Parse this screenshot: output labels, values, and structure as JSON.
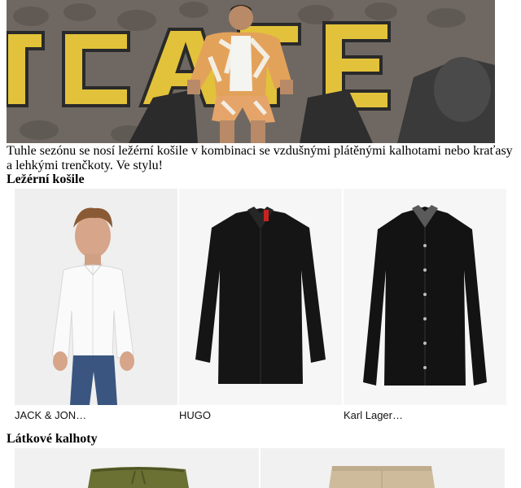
{
  "hero": {
    "image": "man-in-printed-shirt-sitting-on-scooter-photo"
  },
  "intro": {
    "text": "Tuhle sezónu se nosí ležérní košile v kombinaci se vzdušnými plátěnými kalhotami nebo kraťasy a lehkými trenčkoty. Ve stylu!"
  },
  "sections": [
    {
      "title": "Ležérní košile",
      "products": [
        {
          "brand": "JACK & JON…",
          "image": "white-shirt-on-model"
        },
        {
          "brand": "HUGO",
          "image": "black-shirt"
        },
        {
          "brand": "Karl Lager…",
          "image": "black-shirt-patterned-collar"
        }
      ]
    },
    {
      "title": "Látkové kalhoty",
      "products": [
        {
          "brand": "",
          "image": "olive-drawstring-trousers"
        },
        {
          "brand": "",
          "image": "beige-chino-trousers"
        }
      ]
    }
  ],
  "colors": {
    "wall": "#6f6862",
    "graffiti_yellow": "#e2c23a",
    "shirt_black": "#151515",
    "olive": "#6b7033",
    "beige": "#cdbb9c"
  }
}
